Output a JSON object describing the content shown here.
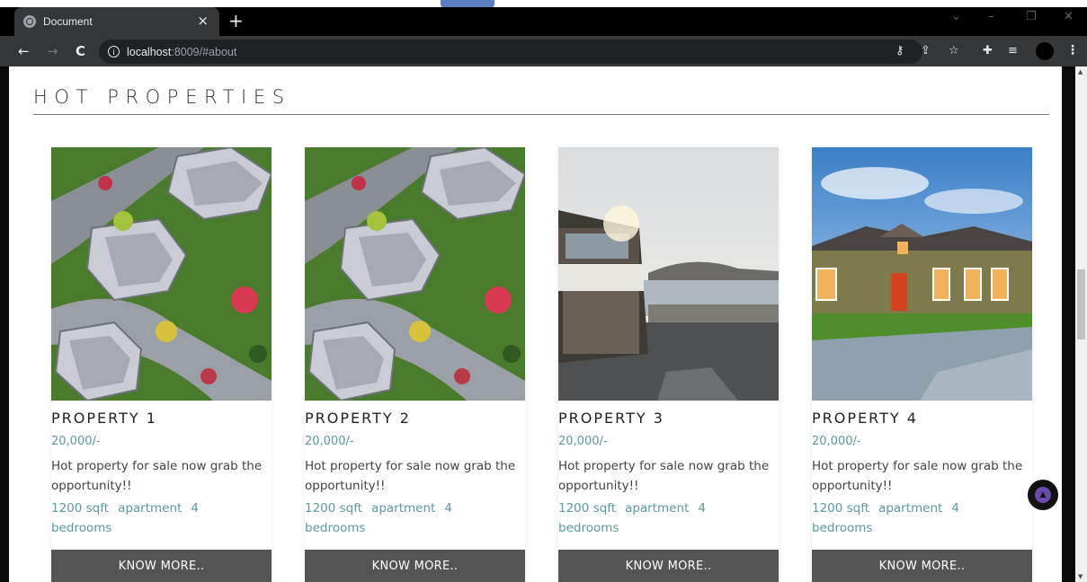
{
  "browser": {
    "tab_title": "Document",
    "tab_close": "×",
    "new_tab": "+",
    "url_host": "localhost",
    "url_path": ":8009/#about",
    "info_glyph": "i",
    "nav_back": "←",
    "nav_forward": "→",
    "nav_reload": "C",
    "icons": [
      "key-icon",
      "share-icon",
      "star-icon",
      "extensions-icon",
      "reading-list-icon",
      "profile-avatar",
      "menu-icon"
    ]
  },
  "section": {
    "title": "HOT PROPERTIES"
  },
  "properties": [
    {
      "name": "PROPERTY 1",
      "price": "20,000/-",
      "description": "Hot property for sale now grab the opportunity!!",
      "sqft": "1200 sqft",
      "type": "apartment",
      "bedrooms": "4 bedrooms",
      "button": "KNOW MORE..",
      "image": "aerial-houses"
    },
    {
      "name": "PROPERTY 2",
      "price": "20,000/-",
      "description": "Hot property for sale now grab the opportunity!!",
      "sqft": "1200 sqft",
      "type": "apartment",
      "bedrooms": "4 bedrooms",
      "button": "KNOW MORE..",
      "image": "aerial-houses"
    },
    {
      "name": "PROPERTY 3",
      "price": "20,000/-",
      "description": "Hot property for sale now grab the opportunity!!",
      "sqft": "1200 sqft",
      "type": "apartment",
      "bedrooms": "4 bedrooms",
      "button": "KNOW MORE..",
      "image": "seaside-villa"
    },
    {
      "name": "PROPERTY 4",
      "price": "20,000/-",
      "description": "Hot property for sale now grab the opportunity!!",
      "sqft": "1200 sqft",
      "type": "apartment",
      "bedrooms": "4 bedrooms",
      "button": "KNOW MORE..",
      "image": "suburban-house"
    }
  ],
  "colors": {
    "accent_text": "#5b9aa0",
    "button_bg": "#545454",
    "scroll_top_accent": "#6b4bb0"
  }
}
